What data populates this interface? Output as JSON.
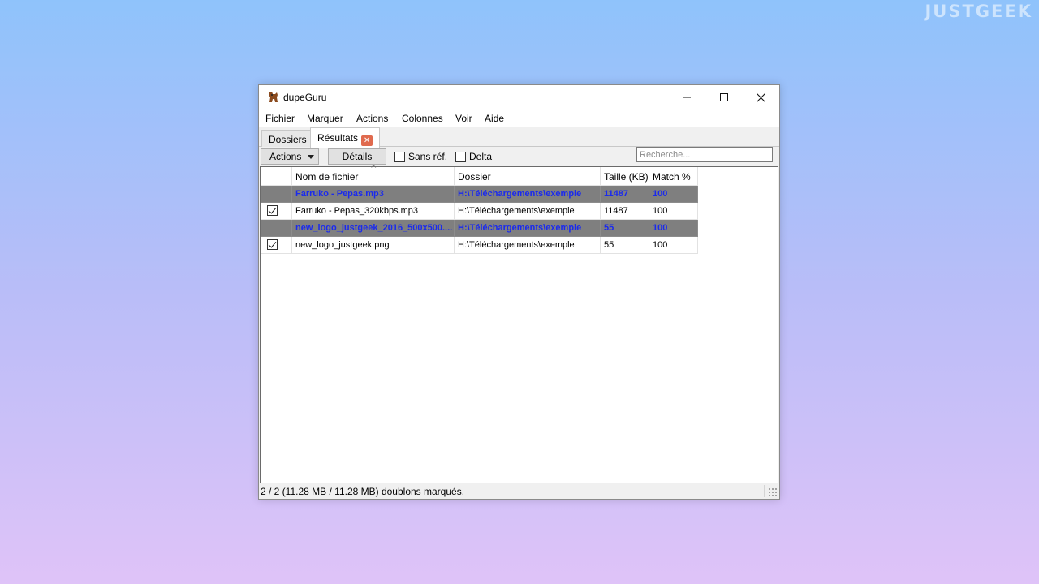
{
  "watermark": "JUSTGEEK",
  "window": {
    "title": "dupeGuru",
    "controls": {
      "minimize": "—",
      "maximize": "☐",
      "close": "✕"
    }
  },
  "menu": [
    "Fichier",
    "Marquer",
    "Actions",
    "Colonnes",
    "Voir",
    "Aide"
  ],
  "tabs": [
    {
      "label": "Dossiers",
      "active": false
    },
    {
      "label": "Résultats",
      "active": true,
      "closable": true
    }
  ],
  "toolbar": {
    "actions_label": "Actions",
    "details_label": "Détails",
    "sans_ref_label": "Sans réf.",
    "sans_ref_checked": false,
    "delta_label": "Delta",
    "delta_checked": false,
    "search_placeholder": "Recherche..."
  },
  "table": {
    "columns": [
      "",
      "Nom de fichier",
      "Dossier",
      "Taille (KB)",
      "Match %"
    ],
    "sorted_column": "Nom de fichier",
    "rows": [
      {
        "type": "ref",
        "checked": null,
        "name": "Farruko - Pepas.mp3",
        "folder": "H:\\Téléchargements\\exemple",
        "size": "11487",
        "match": "100"
      },
      {
        "type": "dupe",
        "checked": true,
        "name": "Farruko - Pepas_320kbps.mp3",
        "folder": "H:\\Téléchargements\\exemple",
        "size": "11487",
        "match": "100"
      },
      {
        "type": "ref",
        "checked": null,
        "name": "new_logo_justgeek_2016_500x500....",
        "folder": "H:\\Téléchargements\\exemple",
        "size": "55",
        "match": "100"
      },
      {
        "type": "dupe",
        "checked": true,
        "name": "new_logo_justgeek.png",
        "folder": "H:\\Téléchargements\\exemple",
        "size": "55",
        "match": "100"
      }
    ]
  },
  "status": {
    "text": "2 / 2 (11.28 MB / 11.28 MB) doublons marqués."
  },
  "colors": {
    "ref_row_bg": "#7f7f7f",
    "ref_row_text": "#1a2aee",
    "tab_close": "#e06a4e"
  }
}
